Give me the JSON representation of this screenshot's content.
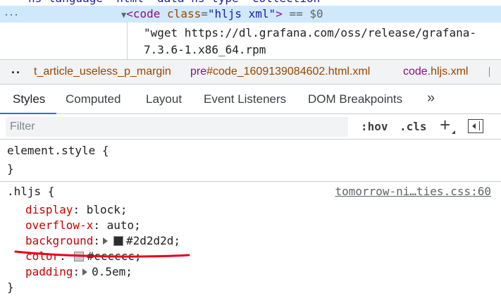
{
  "elements": {
    "top_line": "ns-language=\"html\" data-ns-type=\"collection\"",
    "dots": "···",
    "node": {
      "tag_open": "<code",
      "attr_name": "class",
      "attr_value": "\"hljs xml\"",
      "tag_close": ">",
      "suffix": "== $0"
    },
    "text_line1": "\"wget https://dl.grafana.com/oss/release/grafana-",
    "text_line2": "7.3.6-1.x86_64.rpm"
  },
  "breadcrumb": {
    "more": "..",
    "items": [
      {
        "tag": "",
        "rest": "t_article_useless_p_margin"
      },
      {
        "tag": "pre",
        "rest": "#code_1609139084602.html.xml"
      },
      {
        "tag": "code",
        "rest": ".hljs.xml"
      }
    ]
  },
  "tabs": {
    "styles": "Styles",
    "computed": "Computed",
    "layout": "Layout",
    "listeners": "Event Listeners",
    "dom_breakpoints": "DOM Breakpoints",
    "more": "»"
  },
  "filter": {
    "placeholder": "Filter",
    "hov": ":hov",
    "cls": ".cls",
    "add": "+"
  },
  "rules": {
    "element_style": {
      "selector": "element.style {",
      "close": "}"
    },
    "hljs": {
      "selector": ".hljs {",
      "source": "tomorrow-ni…ties.css:60",
      "close": "}",
      "properties": [
        {
          "name": "display",
          "value": "block;"
        },
        {
          "name": "overflow-x",
          "value": "auto;"
        },
        {
          "name": "background",
          "value": "#2d2d2d;",
          "swatch": "#2d2d2d",
          "expandable": true
        },
        {
          "name": "color",
          "value": "#cccccc;",
          "swatch": "#cccccc"
        },
        {
          "name": "padding",
          "value": "0.5em;",
          "expandable": true
        }
      ]
    }
  },
  "colors": {
    "accent": "#1a73e8",
    "annotation": "#e8001c",
    "selection": "#cfe8fc"
  }
}
